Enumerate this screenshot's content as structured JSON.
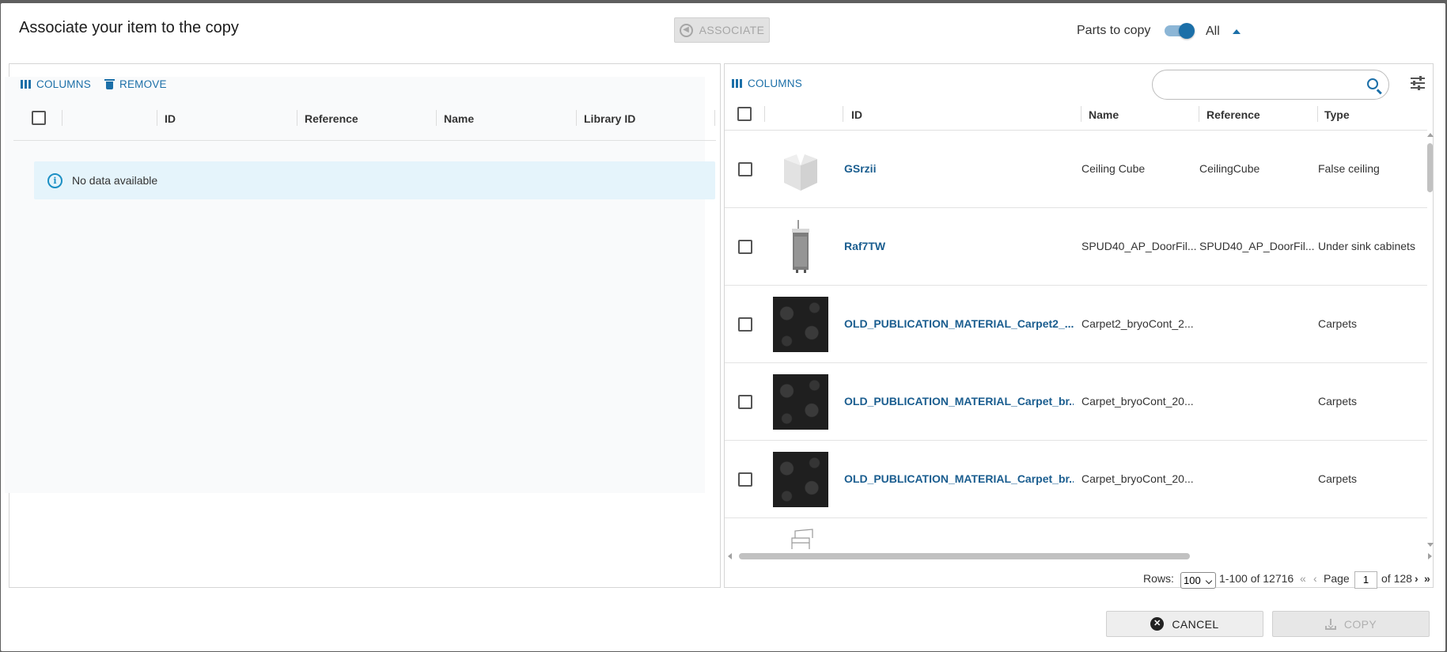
{
  "dialog": {
    "title": "Associate your item to the copy",
    "associate_label": "ASSOCIATE",
    "parts_label": "Parts to copy",
    "parts_value": "All"
  },
  "left": {
    "columns_label": "COLUMNS",
    "remove_label": "REMOVE",
    "headers": [
      "ID",
      "Reference",
      "Name",
      "Library ID"
    ],
    "no_data": "No data available"
  },
  "right": {
    "columns_label": "COLUMNS",
    "search": {
      "placeholder": ""
    },
    "headers": [
      "ID",
      "Name",
      "Reference",
      "Type"
    ],
    "rows": [
      {
        "id": "GSrzii",
        "name": "Ceiling Cube",
        "reference": "CeilingCube",
        "type": "False ceiling",
        "thumb": "cube"
      },
      {
        "id": "Raf7TW",
        "name": "SPUD40_AP_DoorFil...",
        "reference": "SPUD40_AP_DoorFil...",
        "type": "Under sink cabinets",
        "thumb": "cabinet"
      },
      {
        "id": "OLD_PUBLICATION_MATERIAL_Carpet2_...",
        "name": "Carpet2_bryoCont_2...",
        "reference": "",
        "type": "Carpets",
        "thumb": "carpet"
      },
      {
        "id": "OLD_PUBLICATION_MATERIAL_Carpet_br...",
        "name": "Carpet_bryoCont_20...",
        "reference": "",
        "type": "Carpets",
        "thumb": "carpet"
      },
      {
        "id": "OLD_PUBLICATION_MATERIAL_Carpet_br...",
        "name": "Carpet_bryoCont_20...",
        "reference": "",
        "type": "Carpets",
        "thumb": "carpet"
      }
    ],
    "pager": {
      "rows_label": "Rows:",
      "rows_value": "100",
      "range": "1-100 of 12716",
      "first": "«",
      "prev": "‹",
      "page_label": "Page",
      "page_value": "1",
      "of_pages": "of 128",
      "next": "›",
      "last": "»"
    }
  },
  "footer": {
    "cancel_label": "CANCEL",
    "copy_label": "COPY"
  }
}
